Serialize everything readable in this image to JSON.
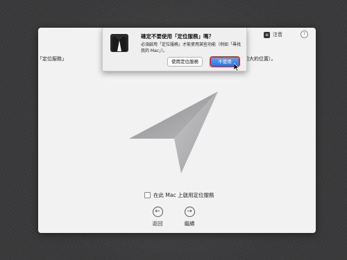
{
  "menu": {
    "icon": "notes-icon",
    "label": "注音"
  },
  "help": {
    "label": "?"
  },
  "setup": {
    "description_left": "「定位服務」",
    "description_right": "的大約位置）。"
  },
  "enable_option": {
    "label": "在此 Mac 上啟用定位服務",
    "checked": false
  },
  "nav": {
    "back_label": "返回",
    "continue_label": "繼續"
  },
  "dialog": {
    "title": "確定不要使用「定位服務」嗎？",
    "message": "必須啟用「定位服務」才能使用某些功能（例如「尋找我的 Mac」）。",
    "secondary_button": "使用定位服務",
    "primary_button": "不使用"
  },
  "colors": {
    "accent": "#2b78e4",
    "highlight": "#e53935"
  }
}
